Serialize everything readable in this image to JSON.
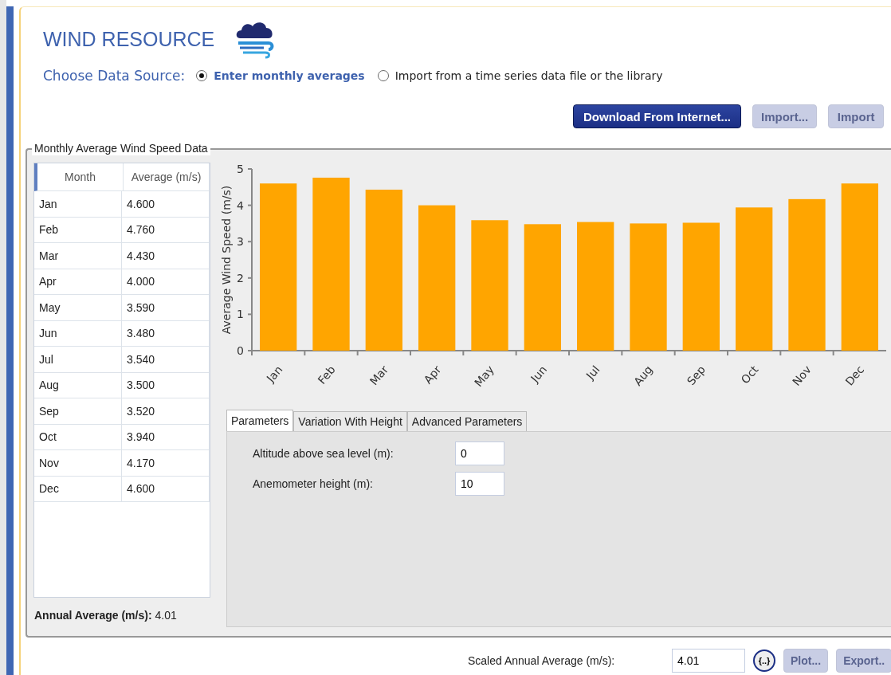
{
  "header": {
    "title": "WIND RESOURCE"
  },
  "data_source": {
    "label": "Choose Data Source:",
    "options": [
      {
        "label": "Enter monthly averages",
        "selected": true
      },
      {
        "label": "Import from a time series data file or the library",
        "selected": false
      }
    ]
  },
  "toolbar_buttons": [
    {
      "label": "Download From Internet...",
      "disabled": false
    },
    {
      "label": "Import...",
      "disabled": true
    },
    {
      "label": "Import",
      "disabled": true
    }
  ],
  "group": {
    "title": "Monthly Average Wind Speed Data",
    "table": {
      "columns": [
        "Month",
        "Average (m/s)"
      ],
      "rows": [
        [
          "Jan",
          "4.600"
        ],
        [
          "Feb",
          "4.760"
        ],
        [
          "Mar",
          "4.430"
        ],
        [
          "Apr",
          "4.000"
        ],
        [
          "May",
          "3.590"
        ],
        [
          "Jun",
          "3.480"
        ],
        [
          "Jul",
          "3.540"
        ],
        [
          "Aug",
          "3.500"
        ],
        [
          "Sep",
          "3.520"
        ],
        [
          "Oct",
          "3.940"
        ],
        [
          "Nov",
          "4.170"
        ],
        [
          "Dec",
          "4.600"
        ]
      ]
    },
    "annual_average": {
      "label": "Annual Average (m/s):",
      "value": "4.01"
    },
    "chart_data": {
      "type": "bar",
      "ylabel": "Average Wind Speed (m/s)",
      "categories": [
        "Jan",
        "Feb",
        "Mar",
        "Apr",
        "May",
        "Jun",
        "Jul",
        "Aug",
        "Sep",
        "Oct",
        "Nov",
        "Dec"
      ],
      "series": [
        {
          "color": "#ffa500",
          "values": [
            4.6,
            4.76,
            4.43,
            4.0,
            3.59,
            3.48,
            3.54,
            3.5,
            3.52,
            3.94,
            4.17,
            4.6
          ]
        }
      ],
      "ylim": [
        0,
        5
      ],
      "yticks": [
        0,
        1,
        2,
        3,
        4,
        5
      ]
    },
    "tabs": [
      {
        "label": "Parameters",
        "selected": true
      },
      {
        "label": "Variation With Height",
        "selected": false
      },
      {
        "label": "Advanced Parameters",
        "selected": false
      }
    ],
    "fields": [
      {
        "label": "Altitude above sea level (m):",
        "value": "0"
      },
      {
        "label": "Anemometer height (m):",
        "value": "10"
      }
    ]
  },
  "footer": {
    "label": "Scaled Annual Average (m/s):",
    "value": "4.01",
    "scale_button": "{..}",
    "buttons": [
      {
        "label": "Plot...",
        "disabled": true
      },
      {
        "label": "Export..",
        "disabled": true
      }
    ]
  }
}
